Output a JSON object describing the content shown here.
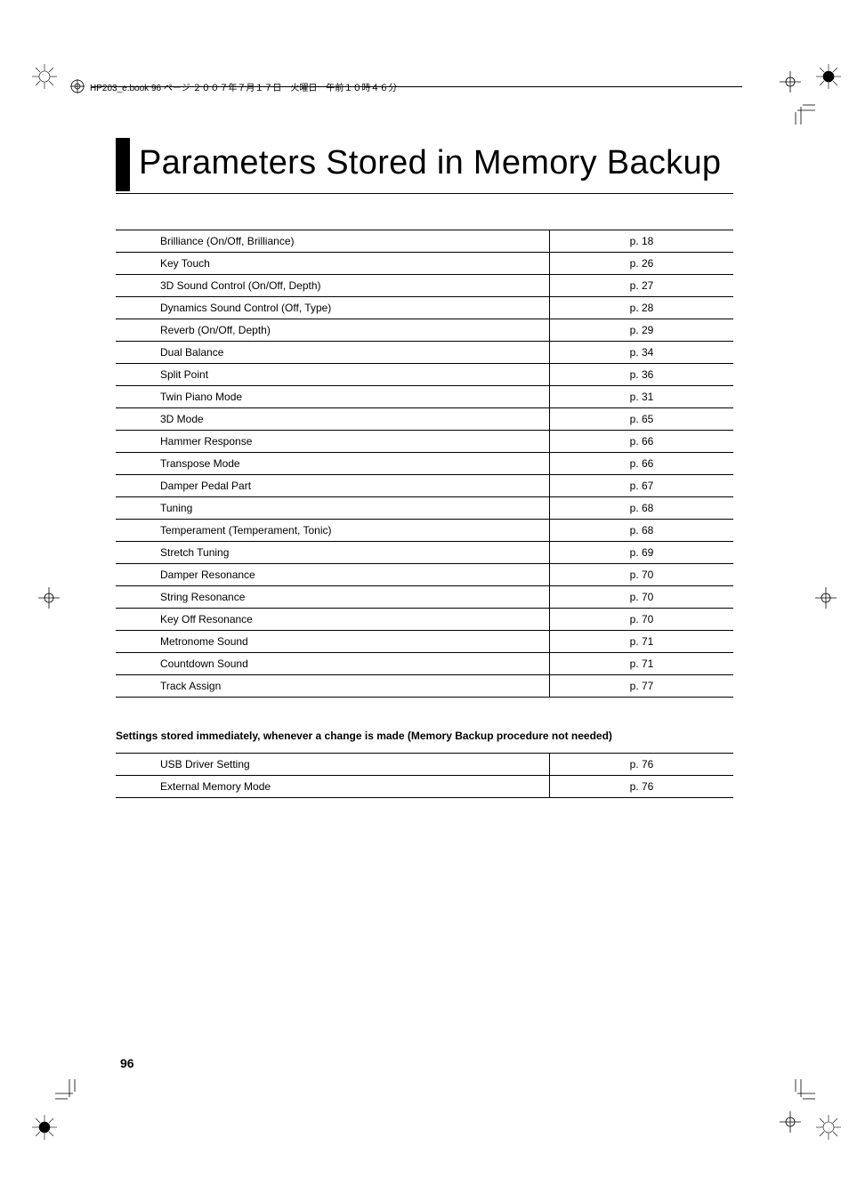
{
  "header_text": "HP203_e.book  96 ページ  ２００７年７月１７日　火曜日　午前１０時４６分",
  "title": "Parameters Stored in Memory Backup",
  "rows_main": [
    {
      "name": "Brilliance (On/Off, Brilliance)",
      "page": "p. 18"
    },
    {
      "name": "Key Touch",
      "page": "p. 26"
    },
    {
      "name": "3D Sound Control (On/Off, Depth)",
      "page": "p. 27"
    },
    {
      "name": "Dynamics Sound Control (Off, Type)",
      "page": "p. 28"
    },
    {
      "name": "Reverb (On/Off, Depth)",
      "page": "p. 29"
    },
    {
      "name": "Dual Balance",
      "page": "p. 34"
    },
    {
      "name": "Split Point",
      "page": "p. 36"
    },
    {
      "name": "Twin Piano Mode",
      "page": "p. 31"
    },
    {
      "name": "3D Mode",
      "page": "p. 65"
    },
    {
      "name": "Hammer Response",
      "page": "p. 66"
    },
    {
      "name": "Transpose Mode",
      "page": "p. 66"
    },
    {
      "name": "Damper Pedal Part",
      "page": "p. 67"
    },
    {
      "name": "Tuning",
      "page": "p. 68"
    },
    {
      "name": "Temperament (Temperament, Tonic)",
      "page": "p. 68"
    },
    {
      "name": "Stretch Tuning",
      "page": "p. 69"
    },
    {
      "name": "Damper Resonance",
      "page": "p. 70"
    },
    {
      "name": "String Resonance",
      "page": "p. 70"
    },
    {
      "name": "Key Off Resonance",
      "page": "p. 70"
    },
    {
      "name": "Metronome Sound",
      "page": "p. 71"
    },
    {
      "name": "Countdown Sound",
      "page": "p. 71"
    },
    {
      "name": "Track Assign",
      "page": "p. 77"
    }
  ],
  "second_heading": "Settings stored immediately, whenever a change is made (Memory Backup procedure not needed)",
  "rows_second": [
    {
      "name": "USB Driver Setting",
      "page": "p. 76"
    },
    {
      "name": "External Memory Mode",
      "page": "p. 76"
    }
  ],
  "page_number": "96"
}
